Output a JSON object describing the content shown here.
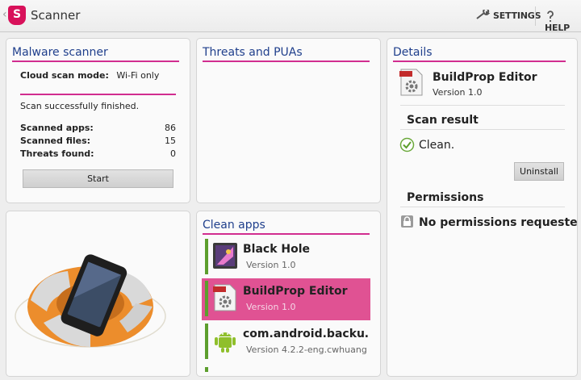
{
  "header": {
    "title": "Scanner",
    "settings_label": "SETTINGS",
    "help_label": "HELP"
  },
  "malware": {
    "title": "Malware scanner",
    "cloud_label": "Cloud scan mode:",
    "cloud_value": "Wi-Fi only",
    "status": "Scan successfully finished.",
    "apps_label": "Scanned apps:",
    "apps_value": "86",
    "files_label": "Scanned files:",
    "files_value": "15",
    "threats_label": "Threats found:",
    "threats_value": "0",
    "start_label": "Start"
  },
  "threats": {
    "title": "Threats and PUAs"
  },
  "clean": {
    "title": "Clean apps",
    "apps": [
      {
        "name": "Black Hole",
        "version": "Version 1.0"
      },
      {
        "name": "BuildProp Editor",
        "version": "Version 1.0"
      },
      {
        "name": "com.android.backu…",
        "version": "Version 4.2.2-eng.cwhuang…"
      }
    ]
  },
  "details": {
    "title": "Details",
    "app_name": "BuildProp Editor",
    "app_version": "Version 1.0",
    "scan_result_heading": "Scan result",
    "scan_result": "Clean.",
    "uninstall_label": "Uninstall",
    "permissions_heading": "Permissions",
    "permissions_text": "No permissions requested.",
    "icon_badge": "PROP"
  },
  "colors": {
    "accent": "#d12d8f",
    "title_blue": "#1f3f8c",
    "selected": "#e05293",
    "ok_green": "#5c9e2d"
  }
}
